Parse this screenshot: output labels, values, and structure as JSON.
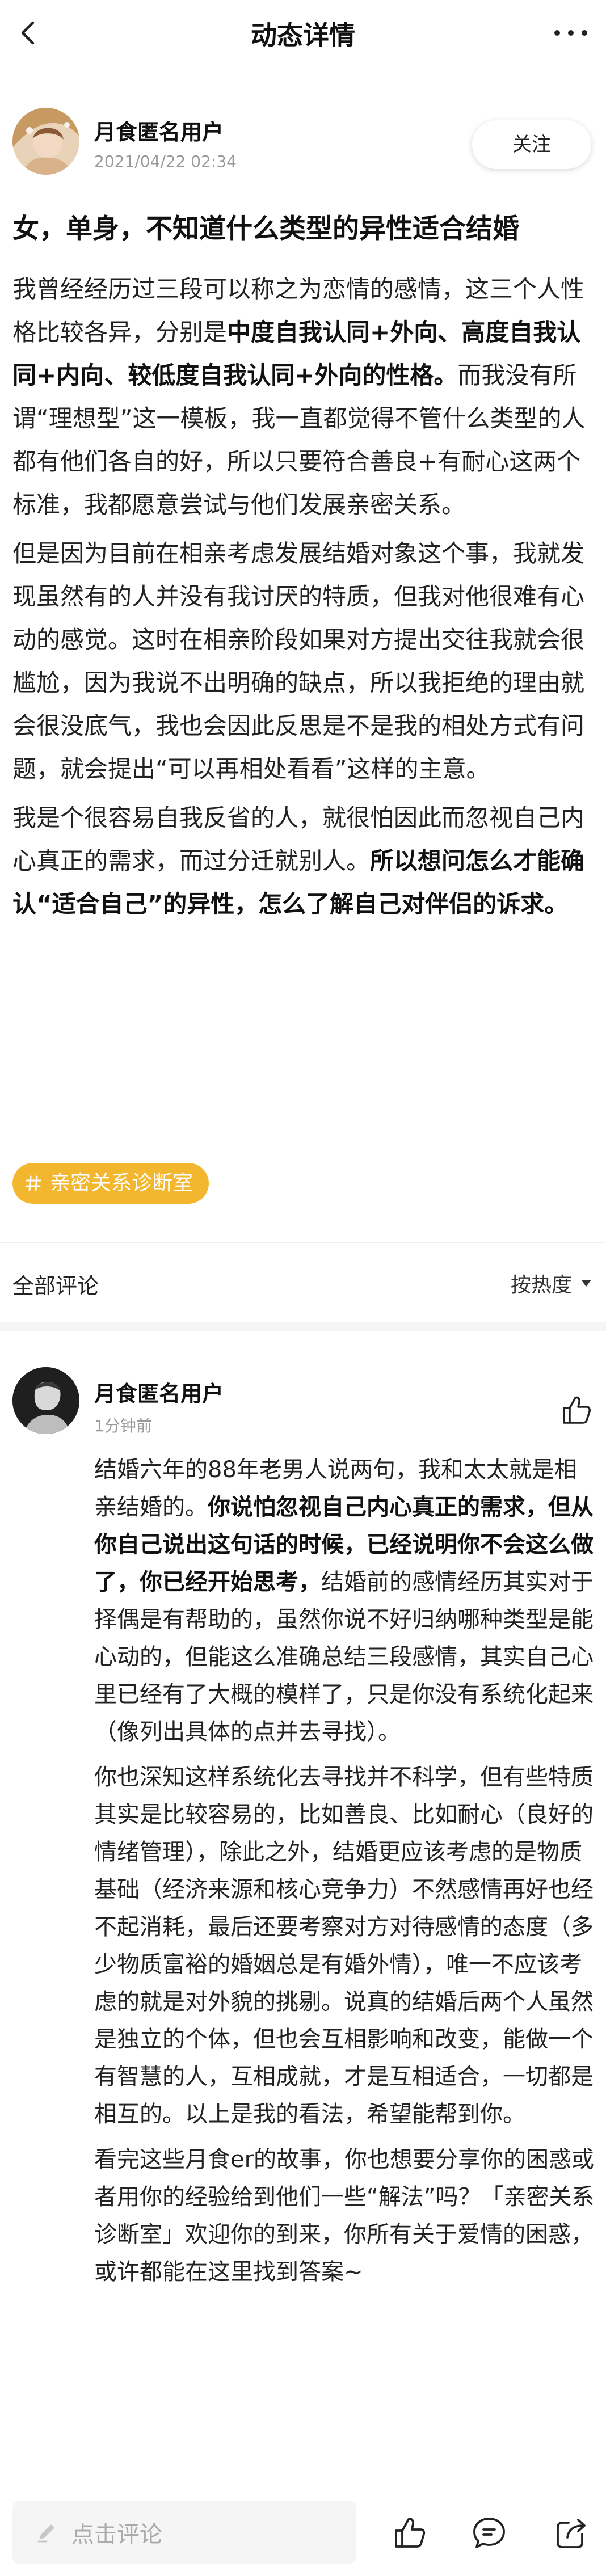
{
  "nav": {
    "title": "动态详情",
    "back_icon": "chevron-left-icon",
    "more_icon": "more-dots-icon"
  },
  "post": {
    "author_name": "月食匿名用户",
    "date": "2021/04/22 02:34",
    "follow_label": "关注",
    "title": "女，单身，不知道什么类型的异性适合结婚",
    "paragraphs": [
      [
        {
          "text": "我曾经经历过三段可以称之为恋情的感情，这三个人性格比较各异，分别是",
          "bold": false
        },
        {
          "text": "中度自我认同+外向、高度自我认同+内向、较低度自我认同+外向的性格。",
          "bold": true
        },
        {
          "text": "而我没有所谓“理想型”这一模板，我一直都觉得不管什么类型的人都有他们各自的好，所以只要符合善良+有耐心这两个标准，我都愿意尝试与他们发展亲密关系。",
          "bold": false
        }
      ],
      [
        {
          "text": "但是因为目前在相亲考虑发展结婚对象这个事，我就发现虽然有的人并没有我讨厌的特质，但我对他很难有心动的感觉。这时在相亲阶段如果对方提出交往我就会很尴尬，因为我说不出明确的缺点，所以我拒绝的理由就会很没底气，我也会因此反思是不是我的相处方式有问题，就会提出“可以再相处看看”这样的主意。",
          "bold": false
        }
      ],
      [
        {
          "text": "我是个很容易自我反省的人，就很怕因此而忽视自己内心真正的需求，而过分迁就别人。",
          "bold": false
        },
        {
          "text": "所以想问怎么才能确认“适合自己”的异性，怎么了解自己对伴侣的诉求。",
          "bold": true
        }
      ]
    ],
    "tag": "亲密关系诊断室",
    "tag_color": "#f3b72f"
  },
  "comments_header": {
    "label": "全部评论",
    "sort_label": "按热度"
  },
  "comment": {
    "author_name": "月食匿名用户",
    "time": "1分钟前",
    "like_icon": "thumbs-up-icon",
    "paragraphs": [
      [
        {
          "text": "结婚六年的88年老男人说两句，我和太太就是相亲结婚的。",
          "bold": false
        },
        {
          "text": "你说怕忽视自己内心真正的需求，但从你自己说出这句话的时候，已经说明你不会这么做了，你已经开始思考，",
          "bold": true
        },
        {
          "text": "结婚前的感情经历其实对于择偶是有帮助的，虽然你说不好归纳哪种类型是能心动的，但能这么准确总结三段感情，其实自己心里已经有了大概的模样了，只是你没有系统化起来（像列出具体的点并去寻找）。",
          "bold": false
        }
      ],
      [
        {
          "text": "你也深知这样系统化去寻找并不科学，但有些特质其实是比较容易的，比如善良、比如耐心（良好的情绪管理），除此之外，结婚更应该考虑的是物质基础（经济来源和核心竞争力）不然感情再好也经不起消耗，最后还要考察对方对待感情的态度（多少物质富裕的婚姻总是有婚外情），唯一不应该考虑的就是对外貌的挑剔。说真的结婚后两个人虽然是独立的个体，但也会互相影响和改变，能做一个有智慧的人，互相成就，才是互相适合，一切都是相互的。以上是我的看法，希望能帮到你。",
          "bold": false
        }
      ],
      [
        {
          "text": "看完这些月食er的故事，你也想要分享你的困惑或者用你的经验给到他们一些“解法”吗？「亲密关系诊断室」欢迎你的到来，你所有关于爱情的困惑，或许都能在这里找到答案~",
          "bold": false
        }
      ]
    ]
  },
  "bottom_bar": {
    "input_placeholder": "点击评论",
    "icons": [
      "pencil-icon",
      "thumbs-up-icon",
      "comment-bubble-icon",
      "share-icon"
    ]
  }
}
